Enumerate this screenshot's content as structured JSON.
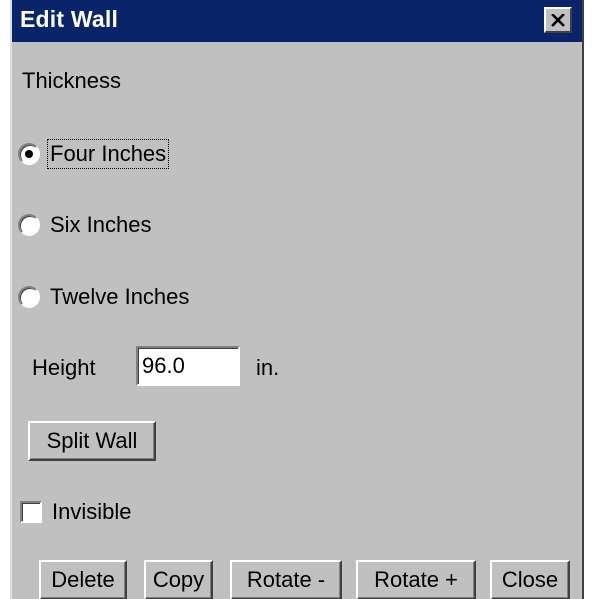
{
  "window": {
    "title": "Edit Wall",
    "close_icon": "close-x-icon"
  },
  "thickness": {
    "label": "Thickness",
    "options": [
      {
        "label": "Four Inches",
        "selected": true,
        "focused": true
      },
      {
        "label": "Six Inches",
        "selected": false,
        "focused": false
      },
      {
        "label": "Twelve Inches",
        "selected": false,
        "focused": false
      }
    ]
  },
  "height": {
    "label": "Height",
    "value": "96.0",
    "unit": "in."
  },
  "split_wall": {
    "label": "Split Wall"
  },
  "invisible": {
    "label": "Invisible",
    "checked": false
  },
  "actions": {
    "delete": "Delete",
    "copy": "Copy",
    "rotate_minus": "Rotate -",
    "rotate_plus": "Rotate +",
    "close": "Close"
  },
  "colors": {
    "title_bar": "#0a246a",
    "dialog_face": "#c0c0c0",
    "title_text": "#ffffff"
  }
}
